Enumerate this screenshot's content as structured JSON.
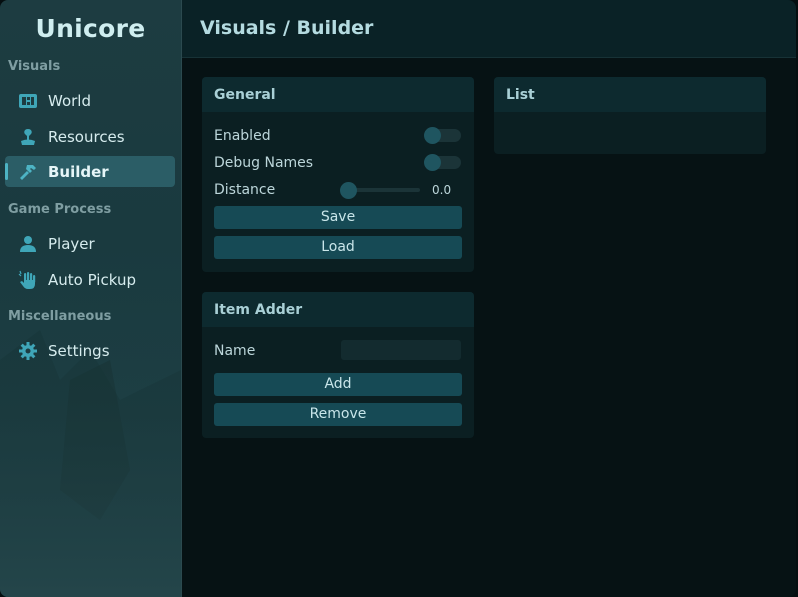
{
  "app": {
    "title": "Unicore"
  },
  "header": {
    "breadcrumb": "Visuals / Builder"
  },
  "sidebar": {
    "sections": [
      {
        "label": "Visuals"
      },
      {
        "label": "Game Process"
      },
      {
        "label": "Miscellaneous"
      }
    ],
    "items": [
      {
        "label": "World",
        "icon": "map-icon"
      },
      {
        "label": "Resources",
        "icon": "plant-icon"
      },
      {
        "label": "Builder",
        "icon": "hammer-icon",
        "active": true
      },
      {
        "label": "Player",
        "icon": "user-icon"
      },
      {
        "label": "Auto Pickup",
        "icon": "hand-pickup-icon"
      },
      {
        "label": "Settings",
        "icon": "gear-icon"
      }
    ]
  },
  "general": {
    "title": "General",
    "enabled_label": "Enabled",
    "enabled_value": false,
    "debug_names_label": "Debug Names",
    "debug_names_value": false,
    "distance_label": "Distance",
    "distance_value": "0.0",
    "save_label": "Save",
    "load_label": "Load"
  },
  "item_adder": {
    "title": "Item Adder",
    "name_label": "Name",
    "name_value": "",
    "add_label": "Add",
    "remove_label": "Remove"
  },
  "list": {
    "title": "List"
  },
  "colors": {
    "accent": "#4db3c4",
    "button": "#164a55",
    "panel": "#0b1f22",
    "panel_header": "#0d2a2f",
    "sidebar": "#1d3c41"
  }
}
